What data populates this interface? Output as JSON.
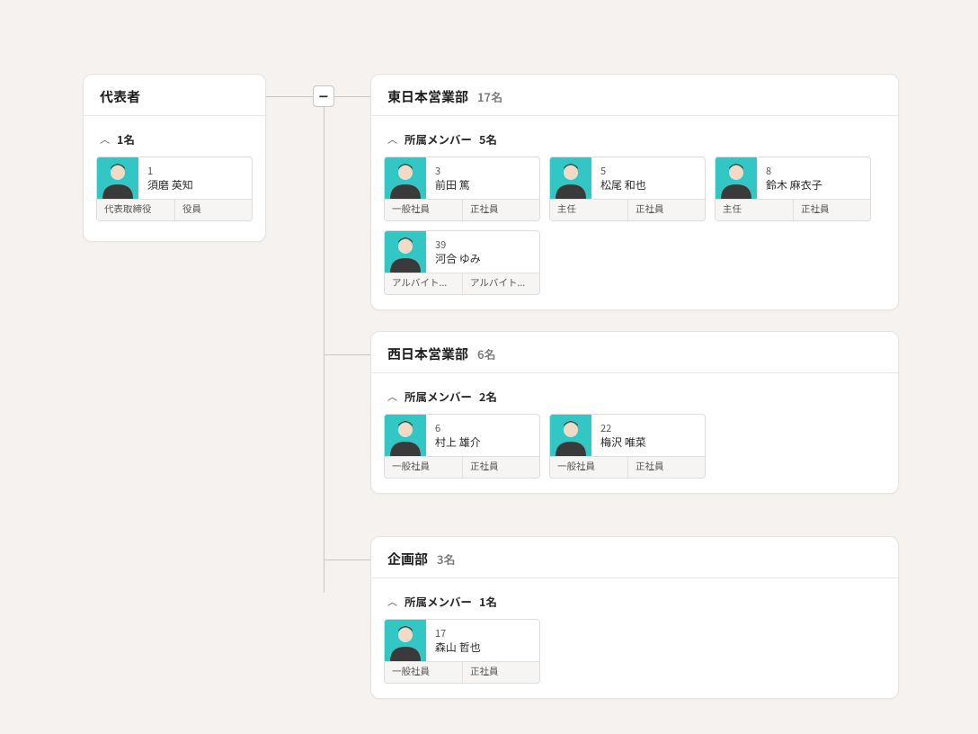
{
  "toggle_glyph": "−",
  "section_label": "所属メンバー",
  "root": {
    "title": "代表者",
    "count": "1名",
    "members": [
      {
        "id": "1",
        "name": "須磨 英知",
        "tag1": "代表取締役",
        "tag2": "役員"
      }
    ]
  },
  "depts": [
    {
      "title": "東日本営業部",
      "count": "17名",
      "section_count": "5名",
      "members": [
        {
          "id": "3",
          "name": "前田 篤",
          "tag1": "一般社員",
          "tag2": "正社員"
        },
        {
          "id": "5",
          "name": "松尾 和也",
          "tag1": "主任",
          "tag2": "正社員"
        },
        {
          "id": "8",
          "name": "鈴木 麻衣子",
          "tag1": "主任",
          "tag2": "正社員"
        },
        {
          "id": "39",
          "name": "河合 ゆみ",
          "tag1": "アルバイト...",
          "tag2": "アルバイト..."
        }
      ]
    },
    {
      "title": "西日本営業部",
      "count": "6名",
      "section_count": "2名",
      "members": [
        {
          "id": "6",
          "name": "村上 雄介",
          "tag1": "一般社員",
          "tag2": "正社員"
        },
        {
          "id": "22",
          "name": "梅沢 唯菜",
          "tag1": "一般社員",
          "tag2": "正社員"
        }
      ]
    },
    {
      "title": "企画部",
      "count": "3名",
      "section_count": "1名",
      "members": [
        {
          "id": "17",
          "name": "森山 哲也",
          "tag1": "一般社員",
          "tag2": "正社員"
        }
      ]
    }
  ]
}
